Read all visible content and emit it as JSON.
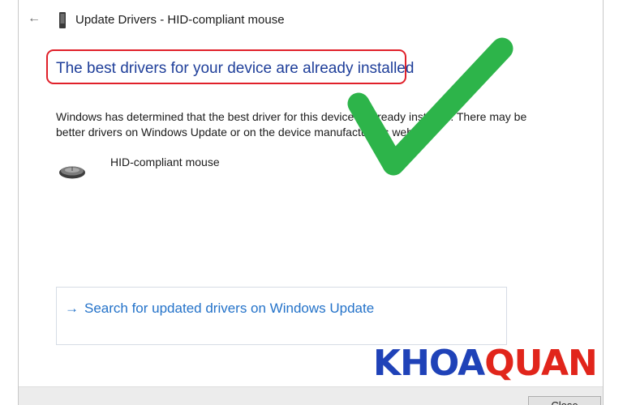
{
  "window": {
    "title": "Update Drivers - HID-compliant mouse",
    "back_glyph": "←",
    "back_icon": "back-arrow-icon",
    "title_icon": "device-icon"
  },
  "main": {
    "heading": "The best drivers for your device are already installed",
    "message": "Windows has determined that the best driver for this device is already installed. There may be better drivers on Windows Update or on the device manufacturer's website.",
    "device_icon": "mouse-icon",
    "device_name": "HID-compliant mouse"
  },
  "search_option": {
    "arrow_glyph": "→",
    "label": "Search for updated drivers on Windows Update"
  },
  "footer": {
    "close_label": "Close"
  },
  "overlay": {
    "checkmark_icon": "green-checkmark-icon",
    "checkmark_color": "#2db44a",
    "highlight_color": "#e0202a",
    "watermark_part1": "KHOA",
    "watermark_part2": "QUAN",
    "watermark_color1": "#1f42b8",
    "watermark_color2": "#e1251b"
  },
  "colors": {
    "heading": "#1f3f9a",
    "link": "#2372c9"
  }
}
